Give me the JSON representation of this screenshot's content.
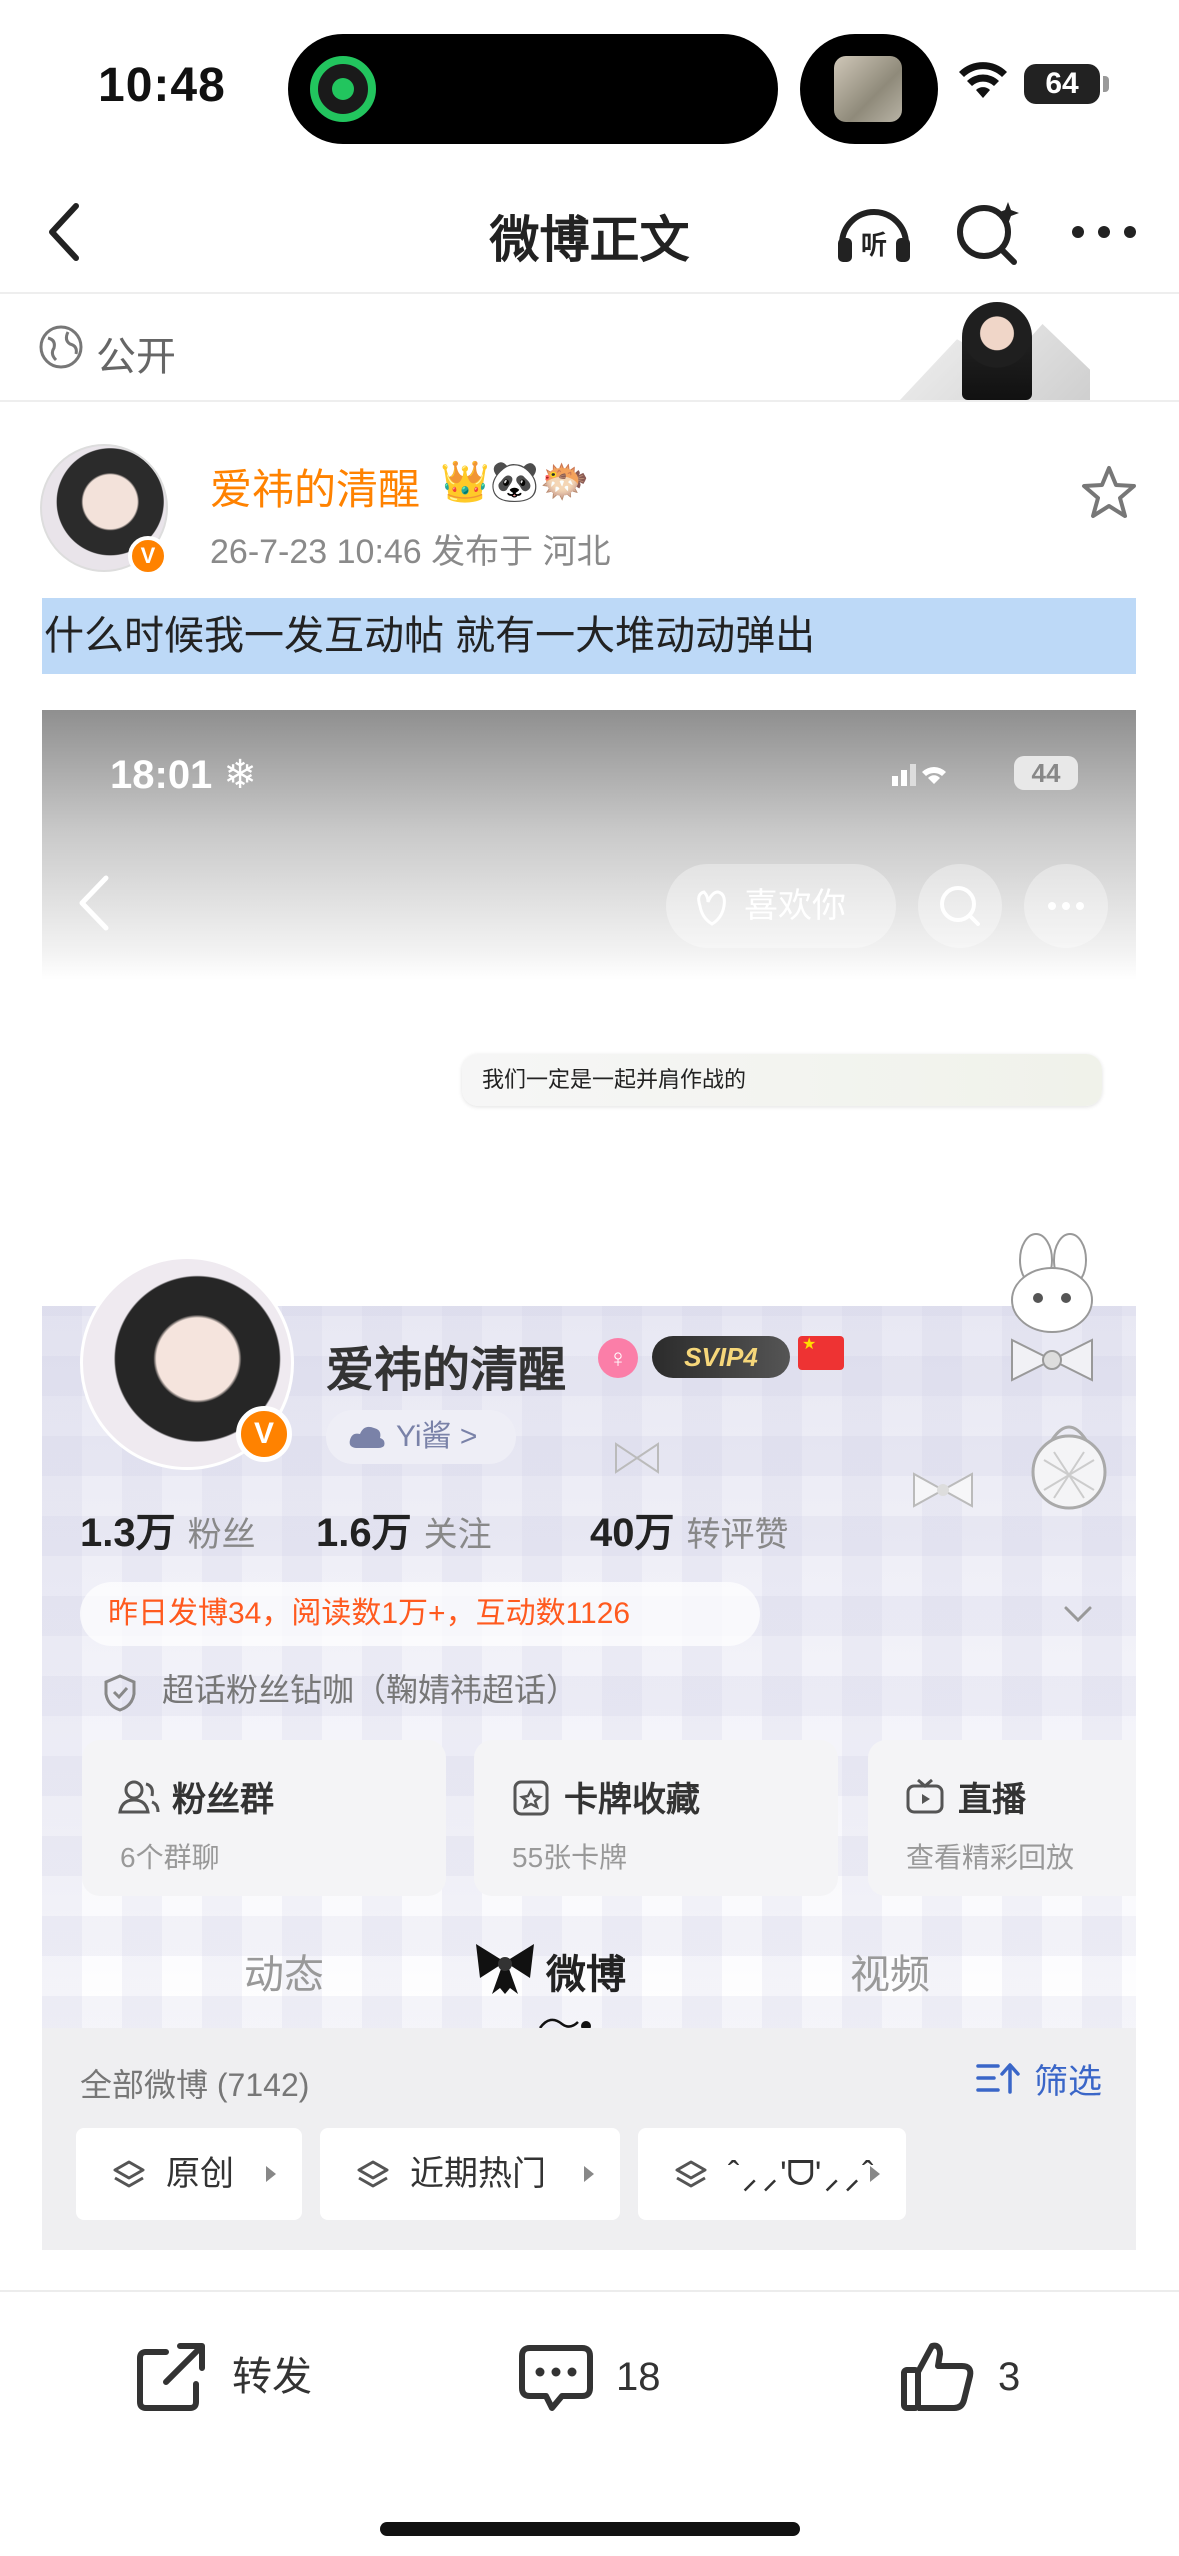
{
  "status_bar": {
    "time": "10:48",
    "battery": "64"
  },
  "nav": {
    "title": "微博正文"
  },
  "visibility": {
    "label": "公开"
  },
  "post": {
    "author_name": "爱祎的清醒",
    "author_badges": "👑🐼🐡",
    "meta": "26-7-23 10:46  发布于 河北",
    "text": "什么时候我一发互动帖  就有一大堆动动弹出"
  },
  "screenshot": {
    "status_time": "18:01 ❄",
    "battery": "44",
    "like_button": "喜欢你",
    "quote": "我们一定是一起并肩作战的",
    "profile": {
      "name": "爱祎的清醒",
      "svip": "SVIP4",
      "tag": "Yi酱 >",
      "stats": [
        {
          "value": "1.3万",
          "label": "粉丝"
        },
        {
          "value": "1.6万",
          "label": "关注"
        },
        {
          "value": "40万",
          "label": "转评赞"
        }
      ],
      "activity": "昨日发博34，阅读数1万+，互动数1126",
      "super_topic": "超话粉丝钻咖（鞠婧祎超话）"
    },
    "cards": [
      {
        "title": "粉丝群",
        "sub": "6个群聊"
      },
      {
        "title": "卡牌收藏",
        "sub": "55张卡牌"
      },
      {
        "title": "直播",
        "sub": "查看精彩回放"
      }
    ],
    "tabs": [
      "动态",
      "微博",
      "视频"
    ],
    "filter": {
      "count": "全部微博 (7142)",
      "filter_label": "筛选",
      "chips": [
        "原创",
        "近期热门",
        "ˆ⸝⸝'ᗜ'⸝⸝ˆ"
      ]
    }
  },
  "actions": {
    "repost": "转发",
    "comments": "18",
    "likes": "3"
  },
  "colors": {
    "accent_orange": "#ff8200",
    "highlight_blue": "#bdd9f7",
    "link_blue": "#3a66c8",
    "activity_red": "#ff5a1f"
  }
}
